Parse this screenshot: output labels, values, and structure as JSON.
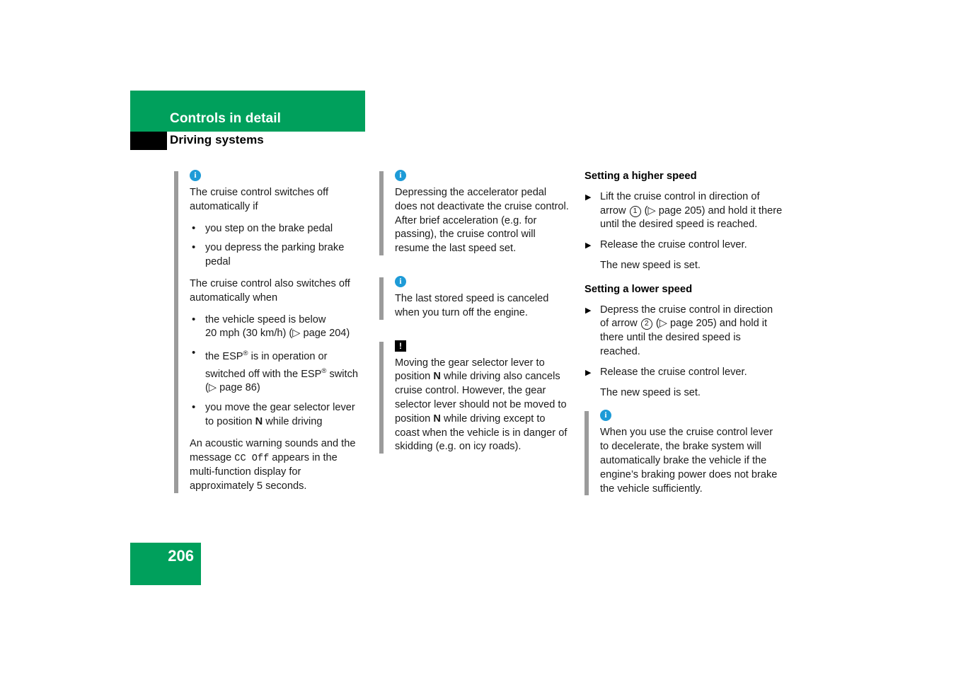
{
  "header": {
    "chapter_title": "Controls in detail",
    "section_title": "Driving systems"
  },
  "footer": {
    "page_number": "206"
  },
  "colors": {
    "brand_green": "#00A05C",
    "info_blue": "#1E9BD7",
    "rule_gray": "#9b9b9b",
    "warning_black": "#000000"
  },
  "icons": {
    "info": "i",
    "warning": "!",
    "page_ref_triangle": "▷",
    "step_triangle": "▶",
    "bullet": "•"
  },
  "column1": {
    "note1": {
      "icon": "info",
      "intro": "The cruise control switches off automatically if",
      "bullets": [
        "you step on the brake pedal",
        "you depress the parking brake pedal"
      ],
      "intro2": "The cruise control also switches off automatically when",
      "bullets2_line1_a": "the vehicle speed is below",
      "bullets2_line1_b": "20 mph (30 km/h) (▷ page 204)",
      "bullets2_line2_a": "the ESP",
      "bullets2_line2_sup": "®",
      "bullets2_line2_b": " is in operation or switched off with the ESP",
      "bullets2_line2_c": " switch",
      "bullets2_line2_d": "(▷ page 86)",
      "bullets2_line3_a": "you move the gear selector lever to position ",
      "bullets2_line3_bold": "N",
      "bullets2_line3_b": " while driving",
      "closing_a": "An acoustic warning sounds and the message ",
      "closing_mono": "CC Off",
      "closing_b": " appears in the multi-function display for approximately 5 seconds."
    }
  },
  "column2": {
    "note1": {
      "icon": "info",
      "text": "Depressing the accelerator pedal does not deactivate the cruise control. After brief acceleration (e.g. for passing), the cruise control will resume the last speed set."
    },
    "note2": {
      "icon": "info",
      "text": "The last stored speed is canceled when you turn off the engine."
    },
    "note3": {
      "icon": "warning",
      "text_a": "Moving the gear selector lever to position ",
      "bold1": "N",
      "text_b": " while driving also cancels cruise control. However, the gear selector lever should not be moved to position ",
      "bold2": "N",
      "text_c": " while driving except to coast when the vehicle is in danger of skidding (e.g. on icy roads)."
    }
  },
  "column3": {
    "heading1": "Setting a higher speed",
    "step1_a": "Lift the cruise control in direction of arrow ",
    "step1_circled": "1",
    "step1_b": " (▷ page 205) and hold it there until the desired speed is reached.",
    "step2": "Release the cruise control lever.",
    "result1": "The new speed is set.",
    "heading2": "Setting a lower speed",
    "step3_a": "Depress the cruise control in direction of arrow ",
    "step3_circled": "2",
    "step3_b": " (▷ page 205) and hold it there until the desired speed is reached.",
    "step4": "Release the cruise control lever.",
    "result2": "The new speed is set.",
    "note1": {
      "icon": "info",
      "text": "When you use the cruise control lever to decelerate, the brake system will automatically brake the vehicle if the engine’s braking power does not brake the vehicle sufficiently."
    }
  }
}
